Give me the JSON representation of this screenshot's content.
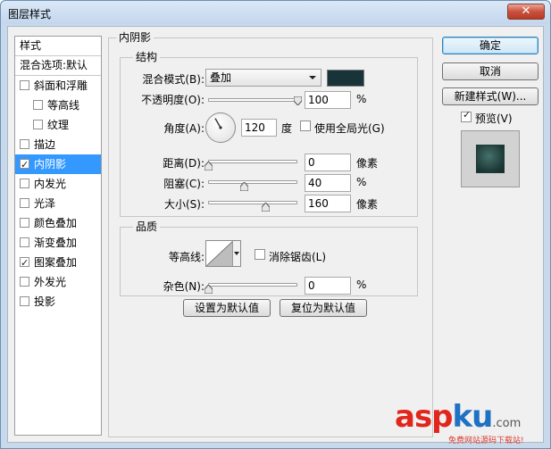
{
  "window": {
    "title": "图层样式",
    "close_label": "✕"
  },
  "left_panel": {
    "header": "样式",
    "blend_options": "混合选项:默认",
    "items": [
      {
        "label": "斜面和浮雕",
        "checked": false,
        "sub": false,
        "selected": false
      },
      {
        "label": "等高线",
        "checked": false,
        "sub": true,
        "selected": false
      },
      {
        "label": "纹理",
        "checked": false,
        "sub": true,
        "selected": false
      },
      {
        "label": "描边",
        "checked": false,
        "sub": false,
        "selected": false
      },
      {
        "label": "内阴影",
        "checked": true,
        "sub": false,
        "selected": true
      },
      {
        "label": "内发光",
        "checked": false,
        "sub": false,
        "selected": false
      },
      {
        "label": "光泽",
        "checked": false,
        "sub": false,
        "selected": false
      },
      {
        "label": "颜色叠加",
        "checked": false,
        "sub": false,
        "selected": false
      },
      {
        "label": "渐变叠加",
        "checked": false,
        "sub": false,
        "selected": false
      },
      {
        "label": "图案叠加",
        "checked": true,
        "sub": false,
        "selected": false
      },
      {
        "label": "外发光",
        "checked": false,
        "sub": false,
        "selected": false
      },
      {
        "label": "投影",
        "checked": false,
        "sub": false,
        "selected": false
      }
    ]
  },
  "inner_shadow": {
    "title": "内阴影",
    "structure": {
      "title": "结构",
      "blend_mode_label": "混合模式(B):",
      "blend_mode_value": "叠加",
      "shadow_color": "#193439",
      "opacity_label": "不透明度(O):",
      "opacity_value": "100",
      "opacity_percent": 100,
      "opacity_unit": "%",
      "angle_label": "角度(A):",
      "angle_value": "120",
      "angle_unit": "度",
      "global_light_label": "使用全局光(G)",
      "global_light_checked": false,
      "distance_label": "距离(D):",
      "distance_value": "0",
      "distance_unit": "像素",
      "choke_label": "阻塞(C):",
      "choke_value": "40",
      "choke_unit": "%",
      "size_label": "大小(S):",
      "size_value": "160",
      "size_unit": "像素"
    },
    "quality": {
      "title": "品质",
      "contour_label": "等高线:",
      "anti_alias_label": "消除锯齿(L)",
      "anti_alias_checked": false,
      "noise_label": "杂色(N):",
      "noise_value": "0",
      "noise_unit": "%"
    },
    "make_default_label": "设置为默认值",
    "reset_default_label": "复位为默认值"
  },
  "actions": {
    "ok_label": "确定",
    "cancel_label": "取消",
    "new_style_label": "新建样式(W)...",
    "preview_label": "预览(V)",
    "preview_checked": true
  },
  "watermark": {
    "asp": "asp",
    "ku": "ku",
    "com": ".com",
    "sub": "免费网站源码下载站!"
  },
  "colors": {
    "accent": "#3399ff",
    "shadow_swatch": "#193439",
    "watermark_red": "#e1261c",
    "watermark_blue": "#1f71c3"
  }
}
